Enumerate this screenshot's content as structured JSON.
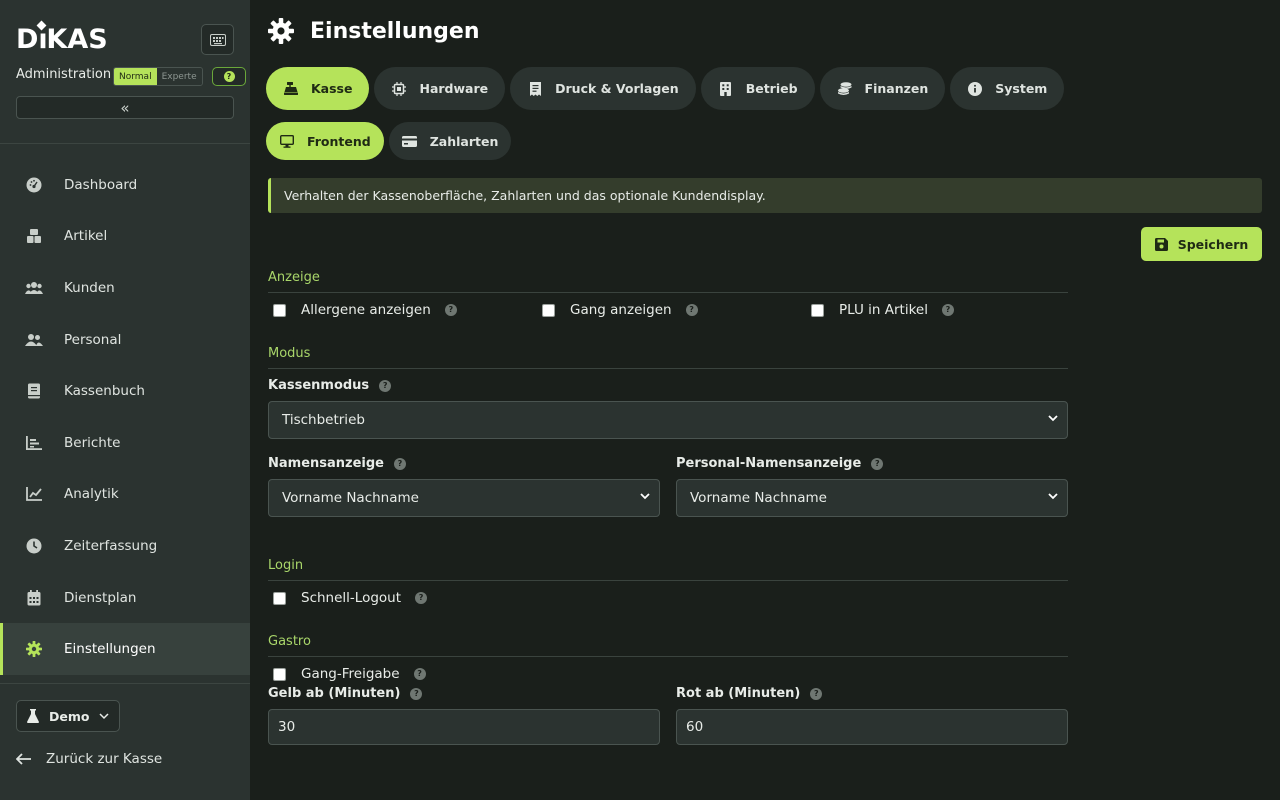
{
  "app": {
    "logo": "DKAS",
    "logo_accent": "i",
    "admin_label": "Administration",
    "mode_normal": "Normal",
    "mode_expert": "Experte",
    "help_symbol": "?",
    "collapse_symbol": "«"
  },
  "nav": {
    "items": [
      {
        "label": "Dashboard",
        "icon": "dashboard-icon"
      },
      {
        "label": "Artikel",
        "icon": "boxes-icon"
      },
      {
        "label": "Kunden",
        "icon": "users-icon"
      },
      {
        "label": "Personal",
        "icon": "user-group-icon"
      },
      {
        "label": "Kassenbuch",
        "icon": "book-icon"
      },
      {
        "label": "Berichte",
        "icon": "bar-chart-icon"
      },
      {
        "label": "Analytik",
        "icon": "line-chart-icon"
      },
      {
        "label": "Zeiterfassung",
        "icon": "clock-icon"
      },
      {
        "label": "Dienstplan",
        "icon": "calendar-icon"
      },
      {
        "label": "Einstellungen",
        "icon": "gear-icon",
        "active": true
      }
    ],
    "demo_label": "Demo",
    "back_label": "Zurück zur Kasse"
  },
  "page": {
    "title": "Einstellungen",
    "tabs": [
      {
        "label": "Kasse",
        "icon": "cash-register-icon",
        "active": true
      },
      {
        "label": "Hardware",
        "icon": "chip-icon"
      },
      {
        "label": "Druck & Vorlagen",
        "icon": "receipt-icon"
      },
      {
        "label": "Betrieb",
        "icon": "building-icon"
      },
      {
        "label": "Finanzen",
        "icon": "coins-icon"
      },
      {
        "label": "System",
        "icon": "info-icon"
      }
    ],
    "subtabs": [
      {
        "label": "Frontend",
        "icon": "monitor-icon",
        "active": true
      },
      {
        "label": "Zahlarten",
        "icon": "credit-card-icon"
      }
    ],
    "info_text": "Verhalten der Kassenoberfläche, Zahlarten und das optionale Kundendisplay.",
    "save_label": "Speichern"
  },
  "sections": {
    "anzeige": {
      "title": "Anzeige",
      "checks": [
        "Allergene anzeigen",
        "Gang anzeigen",
        "PLU in Artikel"
      ]
    },
    "modus": {
      "title": "Modus",
      "kassenmodus_label": "Kassenmodus",
      "kassenmodus_value": "Tischbetrieb",
      "namensanzeige_label": "Namensanzeige",
      "namensanzeige_value": "Vorname Nachname",
      "personal_label": "Personal-Namensanzeige",
      "personal_value": "Vorname Nachname"
    },
    "login": {
      "title": "Login",
      "check": "Schnell-Logout"
    },
    "gastro": {
      "title": "Gastro",
      "check": "Gang-Freigabe",
      "gelb_label": "Gelb ab (Minuten)",
      "gelb_value": "30",
      "rot_label": "Rot ab (Minuten)",
      "rot_value": "60"
    }
  },
  "colors": {
    "accent": "#b5e35a",
    "sidebar_bg": "#2b3330",
    "main_bg": "#1a1f1b",
    "section_title": "#a9d66a"
  }
}
